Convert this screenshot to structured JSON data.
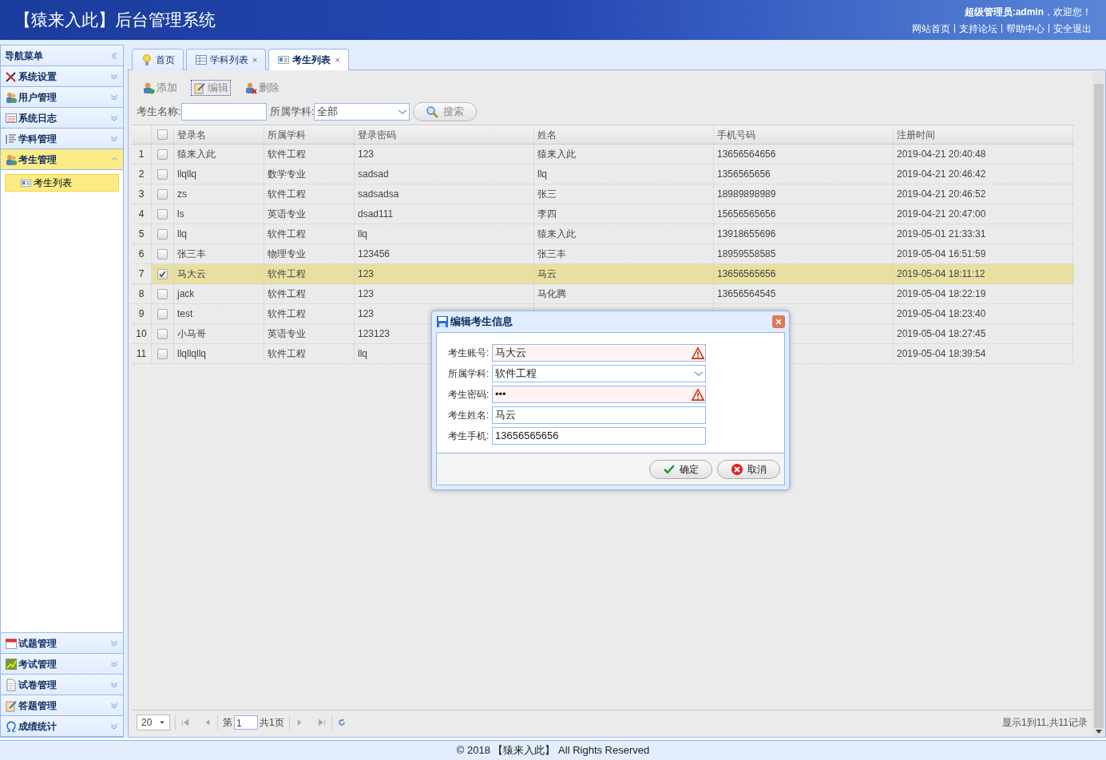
{
  "header": {
    "title": "【猿来入此】后台管理系统",
    "welcome_user": "超级管理员:admin",
    "welcome_suffix": "，欢迎您！",
    "links": [
      "网站首页",
      "支持论坛",
      "帮助中心",
      "安全退出"
    ]
  },
  "sidebar": {
    "title": "导航菜单",
    "top_items": [
      {
        "label": "系统设置",
        "kind": "tools",
        "expanded": false
      },
      {
        "label": "用户管理",
        "kind": "users",
        "expanded": false
      },
      {
        "label": "系统日志",
        "kind": "log",
        "expanded": false
      },
      {
        "label": "学科管理",
        "kind": "list",
        "expanded": false
      },
      {
        "label": "考生管理",
        "kind": "users",
        "expanded": true,
        "children": [
          {
            "label": "考生列表",
            "selected": true
          }
        ]
      }
    ],
    "bottom_items": [
      {
        "label": "试题管理",
        "kind": "calendar",
        "expanded": false
      },
      {
        "label": "考试管理",
        "kind": "chart",
        "expanded": false
      },
      {
        "label": "试卷管理",
        "kind": "doc",
        "expanded": false
      },
      {
        "label": "答题管理",
        "kind": "edit",
        "expanded": false
      },
      {
        "label": "成绩统计",
        "kind": "omega",
        "expanded": false
      }
    ]
  },
  "tabs": [
    {
      "label": "首页",
      "kind": "bulb",
      "selected": false
    },
    {
      "label": "学科列表",
      "kind": "grid",
      "selected": false,
      "close": "×"
    },
    {
      "label": "考生列表",
      "kind": "card",
      "selected": true,
      "close": "×"
    }
  ],
  "toolbar": [
    {
      "label": "添加",
      "kind": "add",
      "focused": false
    },
    {
      "label": "编辑",
      "kind": "edit",
      "focused": true
    },
    {
      "label": "删除",
      "kind": "remove",
      "focused": false
    }
  ],
  "search": {
    "name_label": "考生名称:",
    "subject_label": "所属学科:",
    "subject_value": "全部",
    "button": "搜索"
  },
  "table": {
    "columns": [
      "登录名",
      "所属学科",
      "登录密码",
      "姓名",
      "手机号码",
      "注册时间"
    ],
    "header_checked": false,
    "rows": [
      {
        "index": "1",
        "checked": false,
        "selected": false,
        "cells": [
          "猿来入此",
          "软件工程",
          "123",
          "猿来入此",
          "13656564656",
          "2019-04-21 20:40:48"
        ]
      },
      {
        "index": "2",
        "checked": false,
        "selected": false,
        "cells": [
          "llqllq",
          "数学专业",
          "sadsad",
          "llq",
          "1356565656",
          "2019-04-21 20:46:42"
        ]
      },
      {
        "index": "3",
        "checked": false,
        "selected": false,
        "cells": [
          "zs",
          "软件工程",
          "sadsadsa",
          "张三",
          "18989898989",
          "2019-04-21 20:46:52"
        ]
      },
      {
        "index": "4",
        "checked": false,
        "selected": false,
        "cells": [
          "ls",
          "英语专业",
          "dsad111",
          "李四",
          "15656565656",
          "2019-04-21 20:47:00"
        ]
      },
      {
        "index": "5",
        "checked": false,
        "selected": false,
        "cells": [
          "llq",
          "软件工程",
          "llq",
          "猿来入此",
          "13918655696",
          "2019-05-01 21:33:31"
        ]
      },
      {
        "index": "6",
        "checked": false,
        "selected": false,
        "cells": [
          "张三丰",
          "物理专业",
          "123456",
          "张三丰",
          "18959558585",
          "2019-05-04 16:51:59"
        ]
      },
      {
        "index": "7",
        "checked": true,
        "selected": true,
        "cells": [
          "马大云",
          "软件工程",
          "123",
          "马云",
          "13656565656",
          "2019-05-04 18:11:12"
        ]
      },
      {
        "index": "8",
        "checked": false,
        "selected": false,
        "cells": [
          "jack",
          "软件工程",
          "123",
          "马化腾",
          "13656564545",
          "2019-05-04 18:22:19"
        ]
      },
      {
        "index": "9",
        "checked": false,
        "selected": false,
        "cells": [
          "test",
          "软件工程",
          "123",
          null,
          null,
          "2019-05-04 18:23:40"
        ]
      },
      {
        "index": "10",
        "checked": false,
        "selected": false,
        "cells": [
          "小马哥",
          "英语专业",
          "123123",
          null,
          null,
          "2019-05-04 18:27:45"
        ]
      },
      {
        "index": "11",
        "checked": false,
        "selected": false,
        "cells": [
          "llqllqllq",
          "软件工程",
          "llq",
          null,
          null,
          "2019-05-04 18:39:54"
        ]
      }
    ]
  },
  "pager": {
    "page_size": "20",
    "page_prefix": "第",
    "page": "1",
    "page_total": "共1页",
    "summary": "显示1到11,共11记录"
  },
  "dialog": {
    "title": "编辑考生信息",
    "fields": [
      {
        "label": "考生账号:",
        "value": "马大云",
        "kind": "text",
        "invalid": true
      },
      {
        "label": "所属学科:",
        "value": "软件工程",
        "kind": "combo",
        "invalid": false
      },
      {
        "label": "考生密码:",
        "value": "•••",
        "kind": "text",
        "invalid": true
      },
      {
        "label": "考生姓名:",
        "value": "马云",
        "kind": "text",
        "invalid": false
      },
      {
        "label": "考生手机:",
        "value": "13656565656",
        "kind": "text",
        "invalid": false
      }
    ],
    "buttons": [
      {
        "label": "确定",
        "kind": "ok"
      },
      {
        "label": "取消",
        "kind": "cancel"
      }
    ]
  },
  "footer": "© 2018 【猿来入此】 All Rights Reserved"
}
